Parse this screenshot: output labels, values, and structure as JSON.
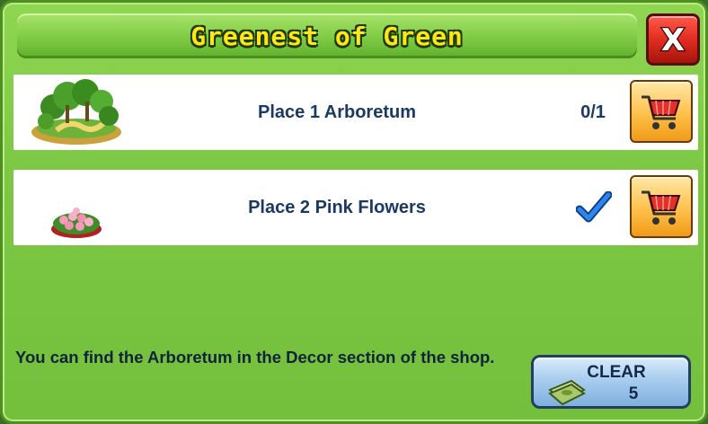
{
  "dialog": {
    "title": "Greenest of Green",
    "close_label": "X"
  },
  "tasks": [
    {
      "label": "Place 1 Arboretum",
      "progress": "0/1",
      "completed": false,
      "icon": "arboretum-icon",
      "shop_icon": "shopping-cart-icon"
    },
    {
      "label": "Place 2 Pink Flowers",
      "progress": "",
      "completed": true,
      "icon": "pink-flowers-icon",
      "shop_icon": "shopping-cart-icon"
    }
  ],
  "hint": {
    "text": "You can find the Arboretum in the Decor section of the shop."
  },
  "clear_button": {
    "label": "CLEAR",
    "cost": "5",
    "currency_icon": "cash-icon"
  },
  "colors": {
    "panel_green": "#7cc844",
    "title_yellow": "#ffe61a",
    "close_red": "#e02d20",
    "label_navy": "#1a3a64",
    "check_blue": "#1565d8",
    "shop_orange": "#ffc04a"
  }
}
